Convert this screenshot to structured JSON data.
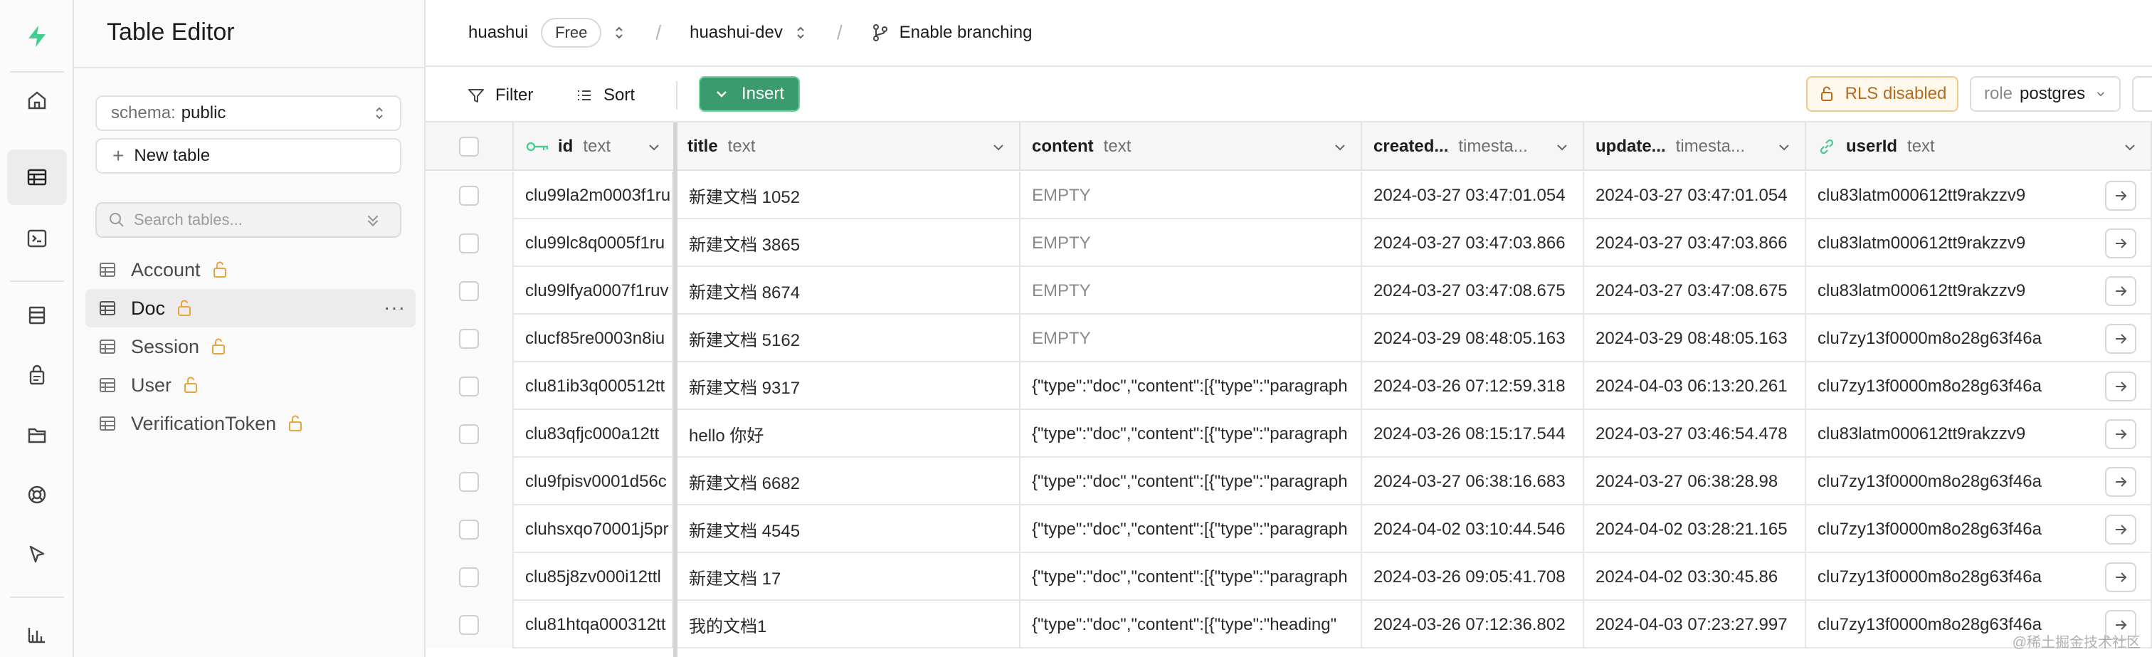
{
  "sidebar": {
    "title": "Table Editor",
    "schema_label": "schema:",
    "schema_value": "public",
    "new_table_label": "New table",
    "search_placeholder": "Search tables...",
    "tables": [
      {
        "name": "Account",
        "active": false
      },
      {
        "name": "Doc",
        "active": true
      },
      {
        "name": "Session",
        "active": false
      },
      {
        "name": "User",
        "active": false
      },
      {
        "name": "VerificationToken",
        "active": false
      }
    ],
    "more_label": "···"
  },
  "topbar": {
    "org": "huashui",
    "plan": "Free",
    "project": "huashui-dev",
    "branching": "Enable branching"
  },
  "toolbar": {
    "filter": "Filter",
    "sort": "Sort",
    "insert": "Insert",
    "rls": "RLS disabled",
    "role_label": "role",
    "role_value": "postgres"
  },
  "columns": [
    {
      "name": "id",
      "type": "text"
    },
    {
      "name": "title",
      "type": "text"
    },
    {
      "name": "content",
      "type": "text"
    },
    {
      "name": "created...",
      "type": "timesta..."
    },
    {
      "name": "update...",
      "type": "timesta..."
    },
    {
      "name": "userId",
      "type": "text"
    }
  ],
  "rows": [
    {
      "id": "clu99la2m0003f1ru",
      "title": "新建文档 1052",
      "content": "EMPTY",
      "created": "2024-03-27 03:47:01.054",
      "updated": "2024-03-27 03:47:01.054",
      "userId": "clu83latm000612tt9rakzzv9"
    },
    {
      "id": "clu99lc8q0005f1ru",
      "title": "新建文档 3865",
      "content": "EMPTY",
      "created": "2024-03-27 03:47:03.866",
      "updated": "2024-03-27 03:47:03.866",
      "userId": "clu83latm000612tt9rakzzv9"
    },
    {
      "id": "clu99lfya0007f1ruv",
      "title": "新建文档 8674",
      "content": "EMPTY",
      "created": "2024-03-27 03:47:08.675",
      "updated": "2024-03-27 03:47:08.675",
      "userId": "clu83latm000612tt9rakzzv9"
    },
    {
      "id": "clucf85re0003n8iu",
      "title": "新建文档 5162",
      "content": "EMPTY",
      "created": "2024-03-29 08:48:05.163",
      "updated": "2024-03-29 08:48:05.163",
      "userId": "clu7zy13f0000m8o28g63f46a"
    },
    {
      "id": "clu81ib3q000512tt",
      "title": "新建文档 9317",
      "content": "{\"type\":\"doc\",\"content\":[{\"type\":\"paragraph",
      "created": "2024-03-26 07:12:59.318",
      "updated": "2024-04-03 06:13:20.261",
      "userId": "clu7zy13f0000m8o28g63f46a"
    },
    {
      "id": "clu83qfjc000a12tt",
      "title": "hello 你好",
      "content": "{\"type\":\"doc\",\"content\":[{\"type\":\"paragraph",
      "created": "2024-03-26 08:15:17.544",
      "updated": "2024-03-27 03:46:54.478",
      "userId": "clu83latm000612tt9rakzzv9"
    },
    {
      "id": "clu9fpisv0001d56c",
      "title": "新建文档 6682",
      "content": "{\"type\":\"doc\",\"content\":[{\"type\":\"paragraph",
      "created": "2024-03-27 06:38:16.683",
      "updated": "2024-03-27 06:38:28.98",
      "userId": "clu7zy13f0000m8o28g63f46a"
    },
    {
      "id": "cluhsxqo70001j5pr",
      "title": "新建文档 4545",
      "content": "{\"type\":\"doc\",\"content\":[{\"type\":\"paragraph",
      "created": "2024-04-02 03:10:44.546",
      "updated": "2024-04-02 03:28:21.165",
      "userId": "clu7zy13f0000m8o28g63f46a"
    },
    {
      "id": "clu85j8zv000i12ttl",
      "title": "新建文档 17",
      "content": "{\"type\":\"doc\",\"content\":[{\"type\":\"paragraph",
      "created": "2024-03-26 09:05:41.708",
      "updated": "2024-04-02 03:30:45.86",
      "userId": "clu7zy13f0000m8o28g63f46a"
    },
    {
      "id": "clu81htqa000312tt",
      "title": "我的文档1",
      "content": "{\"type\":\"doc\",\"content\":[{\"type\":\"heading\"",
      "created": "2024-03-26 07:12:36.802",
      "updated": "2024-04-03 07:23:27.997",
      "userId": "clu7zy13f0000m8o28g63f46a"
    }
  ],
  "watermark": "@稀土掘金技术社区",
  "icons": {
    "rail": [
      "supabase-logo-icon",
      "home-icon",
      "table-editor-icon",
      "sql-editor-icon",
      "database-icon",
      "auth-icon",
      "storage-icon",
      "edge-functions-icon",
      "realtime-icon",
      "reports-icon"
    ],
    "accent": "#3ecf8e",
    "insert_bg": "#3a9b6e",
    "rls_color": "#b7691c",
    "lock_color": "#e8a33c"
  }
}
